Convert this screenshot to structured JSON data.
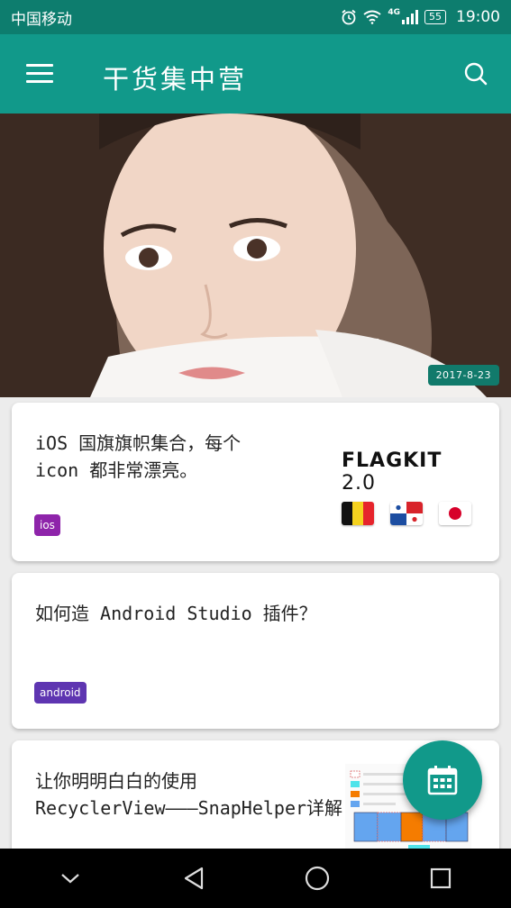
{
  "status_bar": {
    "carrier": "中国移动",
    "network_type": "4G",
    "battery_level": "55",
    "time": "19:00"
  },
  "toolbar": {
    "title": "干货集中营",
    "menu_icon": "hamburger-menu-icon",
    "search_icon": "search-icon"
  },
  "hero": {
    "date": "2017-8-23"
  },
  "articles": [
    {
      "title_line1": "iOS 国旗旗帜集合，每个",
      "title_line2": "icon 都非常漂亮。",
      "tag": "ios",
      "preview_title": "FLAGKIT",
      "preview_version": "2.0"
    },
    {
      "title_line1": "如何造 Android Studio 插件？",
      "tag": "android"
    },
    {
      "title_line1": "让你明明白白的使用",
      "title_line2": "RecyclerView———SnapHelper详解"
    }
  ],
  "fab": {
    "icon": "calendar-icon"
  },
  "nav_bar": {
    "icons": [
      "chevron-down-icon",
      "back-triangle-icon",
      "home-circle-icon",
      "recents-square-icon"
    ]
  },
  "colors": {
    "status_bar": "#0d7d6e",
    "primary": "#11998a",
    "tag_ios": "#8e24aa",
    "tag_android": "#5e35b1"
  }
}
